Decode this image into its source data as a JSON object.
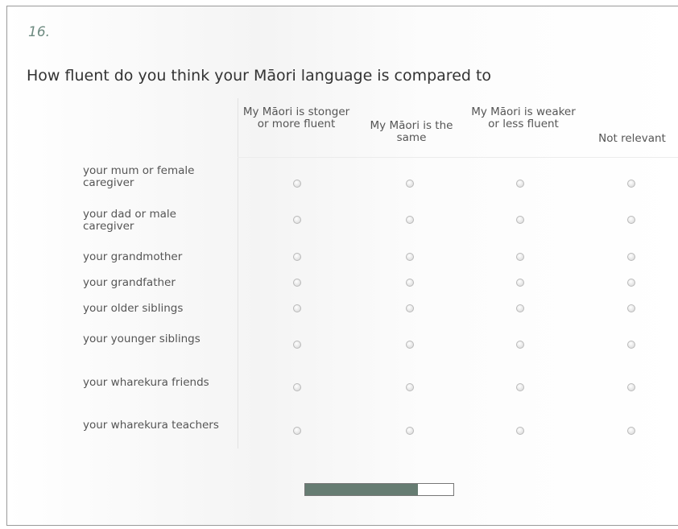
{
  "question": {
    "number": "16.",
    "text": "How fluent do you think your Māori language is compared to"
  },
  "columns": [
    {
      "label": "My Māori is stonger or more fluent"
    },
    {
      "label": "My Māori is the same"
    },
    {
      "label": "My Māori is weaker or less fluent"
    },
    {
      "label": "Not relevant"
    }
  ],
  "rows": [
    {
      "label": "your mum or female caregiver",
      "selected": null
    },
    {
      "label": "your dad or male caregiver",
      "selected": null
    },
    {
      "label": "your grandmother",
      "selected": null
    },
    {
      "label": "your grandfather",
      "selected": null
    },
    {
      "label": "your older siblings",
      "selected": null
    },
    {
      "label": "your younger siblings",
      "selected": null
    },
    {
      "label": "your wharekura friends",
      "selected": null
    },
    {
      "label": "your wharekura teachers",
      "selected": null
    }
  ],
  "progress": {
    "fraction": 0.76
  },
  "colors": {
    "accent": "#667c72",
    "question_number": "#6d8a80"
  }
}
